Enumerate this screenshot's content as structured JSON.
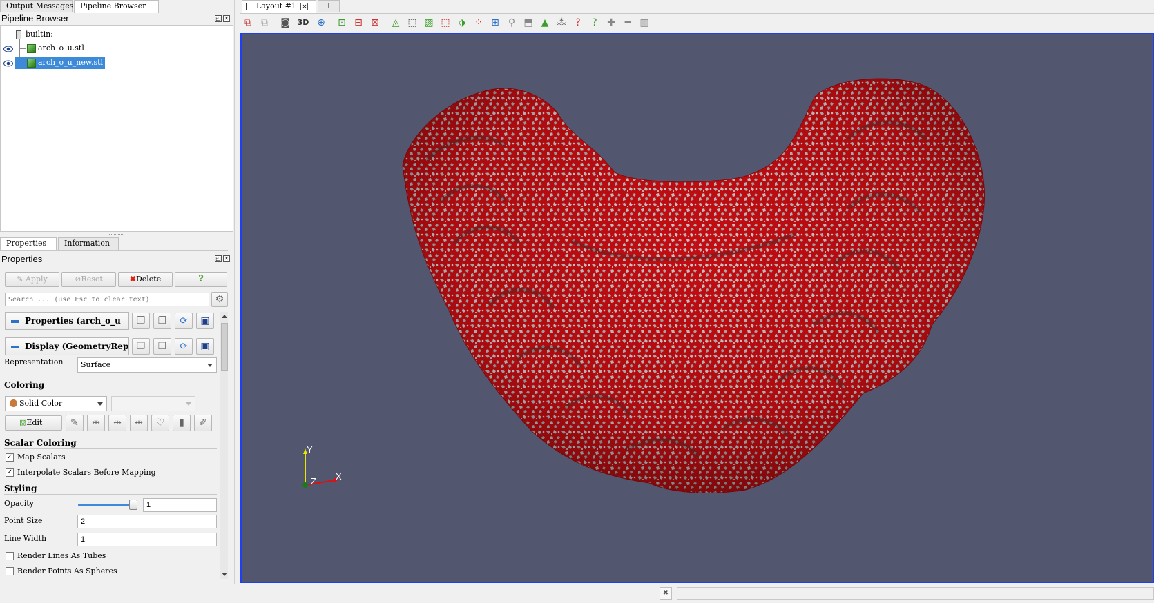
{
  "left_tabs": {
    "output_messages": "Output Messages",
    "pipeline_browser": "Pipeline Browser"
  },
  "pipeline": {
    "title": "Pipeline Browser",
    "root": "builtin:",
    "items": [
      {
        "label": "arch_o_u.stl",
        "visible": true,
        "selected": false
      },
      {
        "label": "arch_o_u_new.stl",
        "visible": true,
        "selected": true
      }
    ]
  },
  "prop_tabs": {
    "properties": "Properties",
    "information": "Information"
  },
  "properties": {
    "title": "Properties",
    "apply": "Apply",
    "reset": "Reset",
    "delete": "Delete",
    "help": "?",
    "search_placeholder": "Search ... (use Esc to clear text)",
    "section_properties": "Properties (arch_o_u",
    "section_display": "Display (GeometryRep",
    "representation_label": "Representation",
    "representation_value": "Surface",
    "coloring_header": "Coloring",
    "coloring_value": "Solid Color",
    "solid_color": "#c77a3a",
    "edit_label": "Edit",
    "scalar_coloring_header": "Scalar Coloring",
    "map_scalars": "Map Scalars",
    "map_scalars_checked": true,
    "interpolate": "Interpolate Scalars Before Mapping",
    "interpolate_checked": true,
    "styling_header": "Styling",
    "opacity_label": "Opacity",
    "opacity_value": "1",
    "opacity_fraction": 1,
    "point_size_label": "Point Size",
    "point_size_value": "2",
    "line_width_label": "Line Width",
    "line_width_value": "1",
    "render_lines_tubes": "Render Lines As Tubes",
    "render_points_spheres": "Render Points As Spheres"
  },
  "layout_tab": {
    "label": "Layout #1",
    "add": "+"
  },
  "toolbar": {
    "mode_3d": "3D"
  },
  "viewport": {
    "background": "#52566f",
    "mesh_red": "#c40d12",
    "mesh_gray": "#b8b8b8",
    "axes": {
      "x": "X",
      "y": "Y",
      "z": "Z"
    }
  }
}
